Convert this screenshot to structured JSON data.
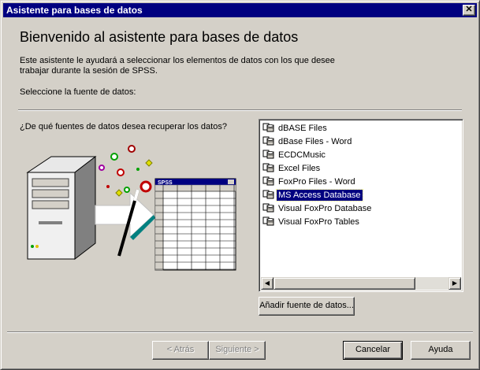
{
  "window": {
    "title": "Asistente para bases de datos",
    "close_glyph": "✕"
  },
  "header": {
    "heading": "Bienvenido al asistente para bases de datos",
    "intro_line1": "Este asistente le ayudará a seleccionar los elementos de datos con los que desee",
    "intro_line2": "trabajar durante la sesión de SPSS.",
    "source_prompt": "Seleccione la fuente de datos:"
  },
  "main": {
    "question": "¿De qué fuentes de datos desea recuperar los datos?",
    "illustration_label": "SPSS",
    "data_sources": [
      {
        "label": "dBASE Files",
        "selected": false
      },
      {
        "label": "dBase Files - Word",
        "selected": false
      },
      {
        "label": "ECDCMusic",
        "selected": false
      },
      {
        "label": "Excel Files",
        "selected": false
      },
      {
        "label": "FoxPro Files - Word",
        "selected": false
      },
      {
        "label": "MS Access Database",
        "selected": true
      },
      {
        "label": "Visual FoxPro Database",
        "selected": false
      },
      {
        "label": "Visual FoxPro Tables",
        "selected": false
      }
    ],
    "add_source_label": "Añadir fuente de datos..."
  },
  "footer": {
    "back_label": "< Atrás",
    "next_label": "Siguiente >",
    "cancel_label": "Cancelar",
    "help_label": "Ayuda"
  },
  "colors": {
    "title_bar": "#000080",
    "selection": "#000080",
    "face": "#d4d0c8"
  }
}
